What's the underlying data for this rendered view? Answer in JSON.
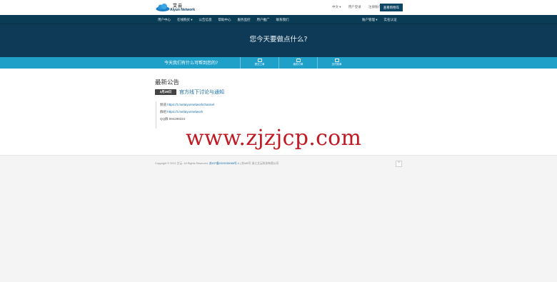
{
  "brand": {
    "name_cn": "艾云",
    "name_en": "Aiyun Network"
  },
  "top_links": {
    "language": "中文 ▾",
    "login": "用户登录",
    "register": "注册账户",
    "cart": "查看购物车"
  },
  "nav": {
    "left": [
      "用户中心",
      "在线购买 ▾",
      "公告信息",
      "帮助中心",
      "服务监控",
      "用户推广",
      "联系我们"
    ],
    "right": [
      "账户管理 ▾",
      "实名认证"
    ]
  },
  "hero": {
    "title": "您今天要做点什么?"
  },
  "actionbar": {
    "prompt": "今天我们有什么可帮到您的?",
    "buttons": [
      "提交工单",
      "我的订单",
      "支付账单"
    ]
  },
  "announcements": {
    "section_title": "最新公告",
    "date": "3月28日",
    "headline": "官方线下讨论与通知",
    "lines": [
      {
        "label": "频道 ",
        "link": "https://t.me/aiyunnetworkchannel"
      },
      {
        "label": "群组 ",
        "link": "https://t.me/aiyunnetwork"
      },
      {
        "label": "QQ群 994298224",
        "link": ""
      }
    ]
  },
  "watermark": "www.zjzjcp.com",
  "footer": {
    "copyright": "Copyright © 2021 艾云. All Rights Reserved.",
    "icp": "苏ICP备2020038088号-1",
    "company": " | 苏MB号 浙江艾云科技有限公司",
    "totop": "^"
  },
  "colors": {
    "navbar": "#0b3c55",
    "hero": "#0e3a57",
    "actionbar": "#1fa0c9",
    "link": "#1a6ea8",
    "watermark": "#c01b24"
  }
}
